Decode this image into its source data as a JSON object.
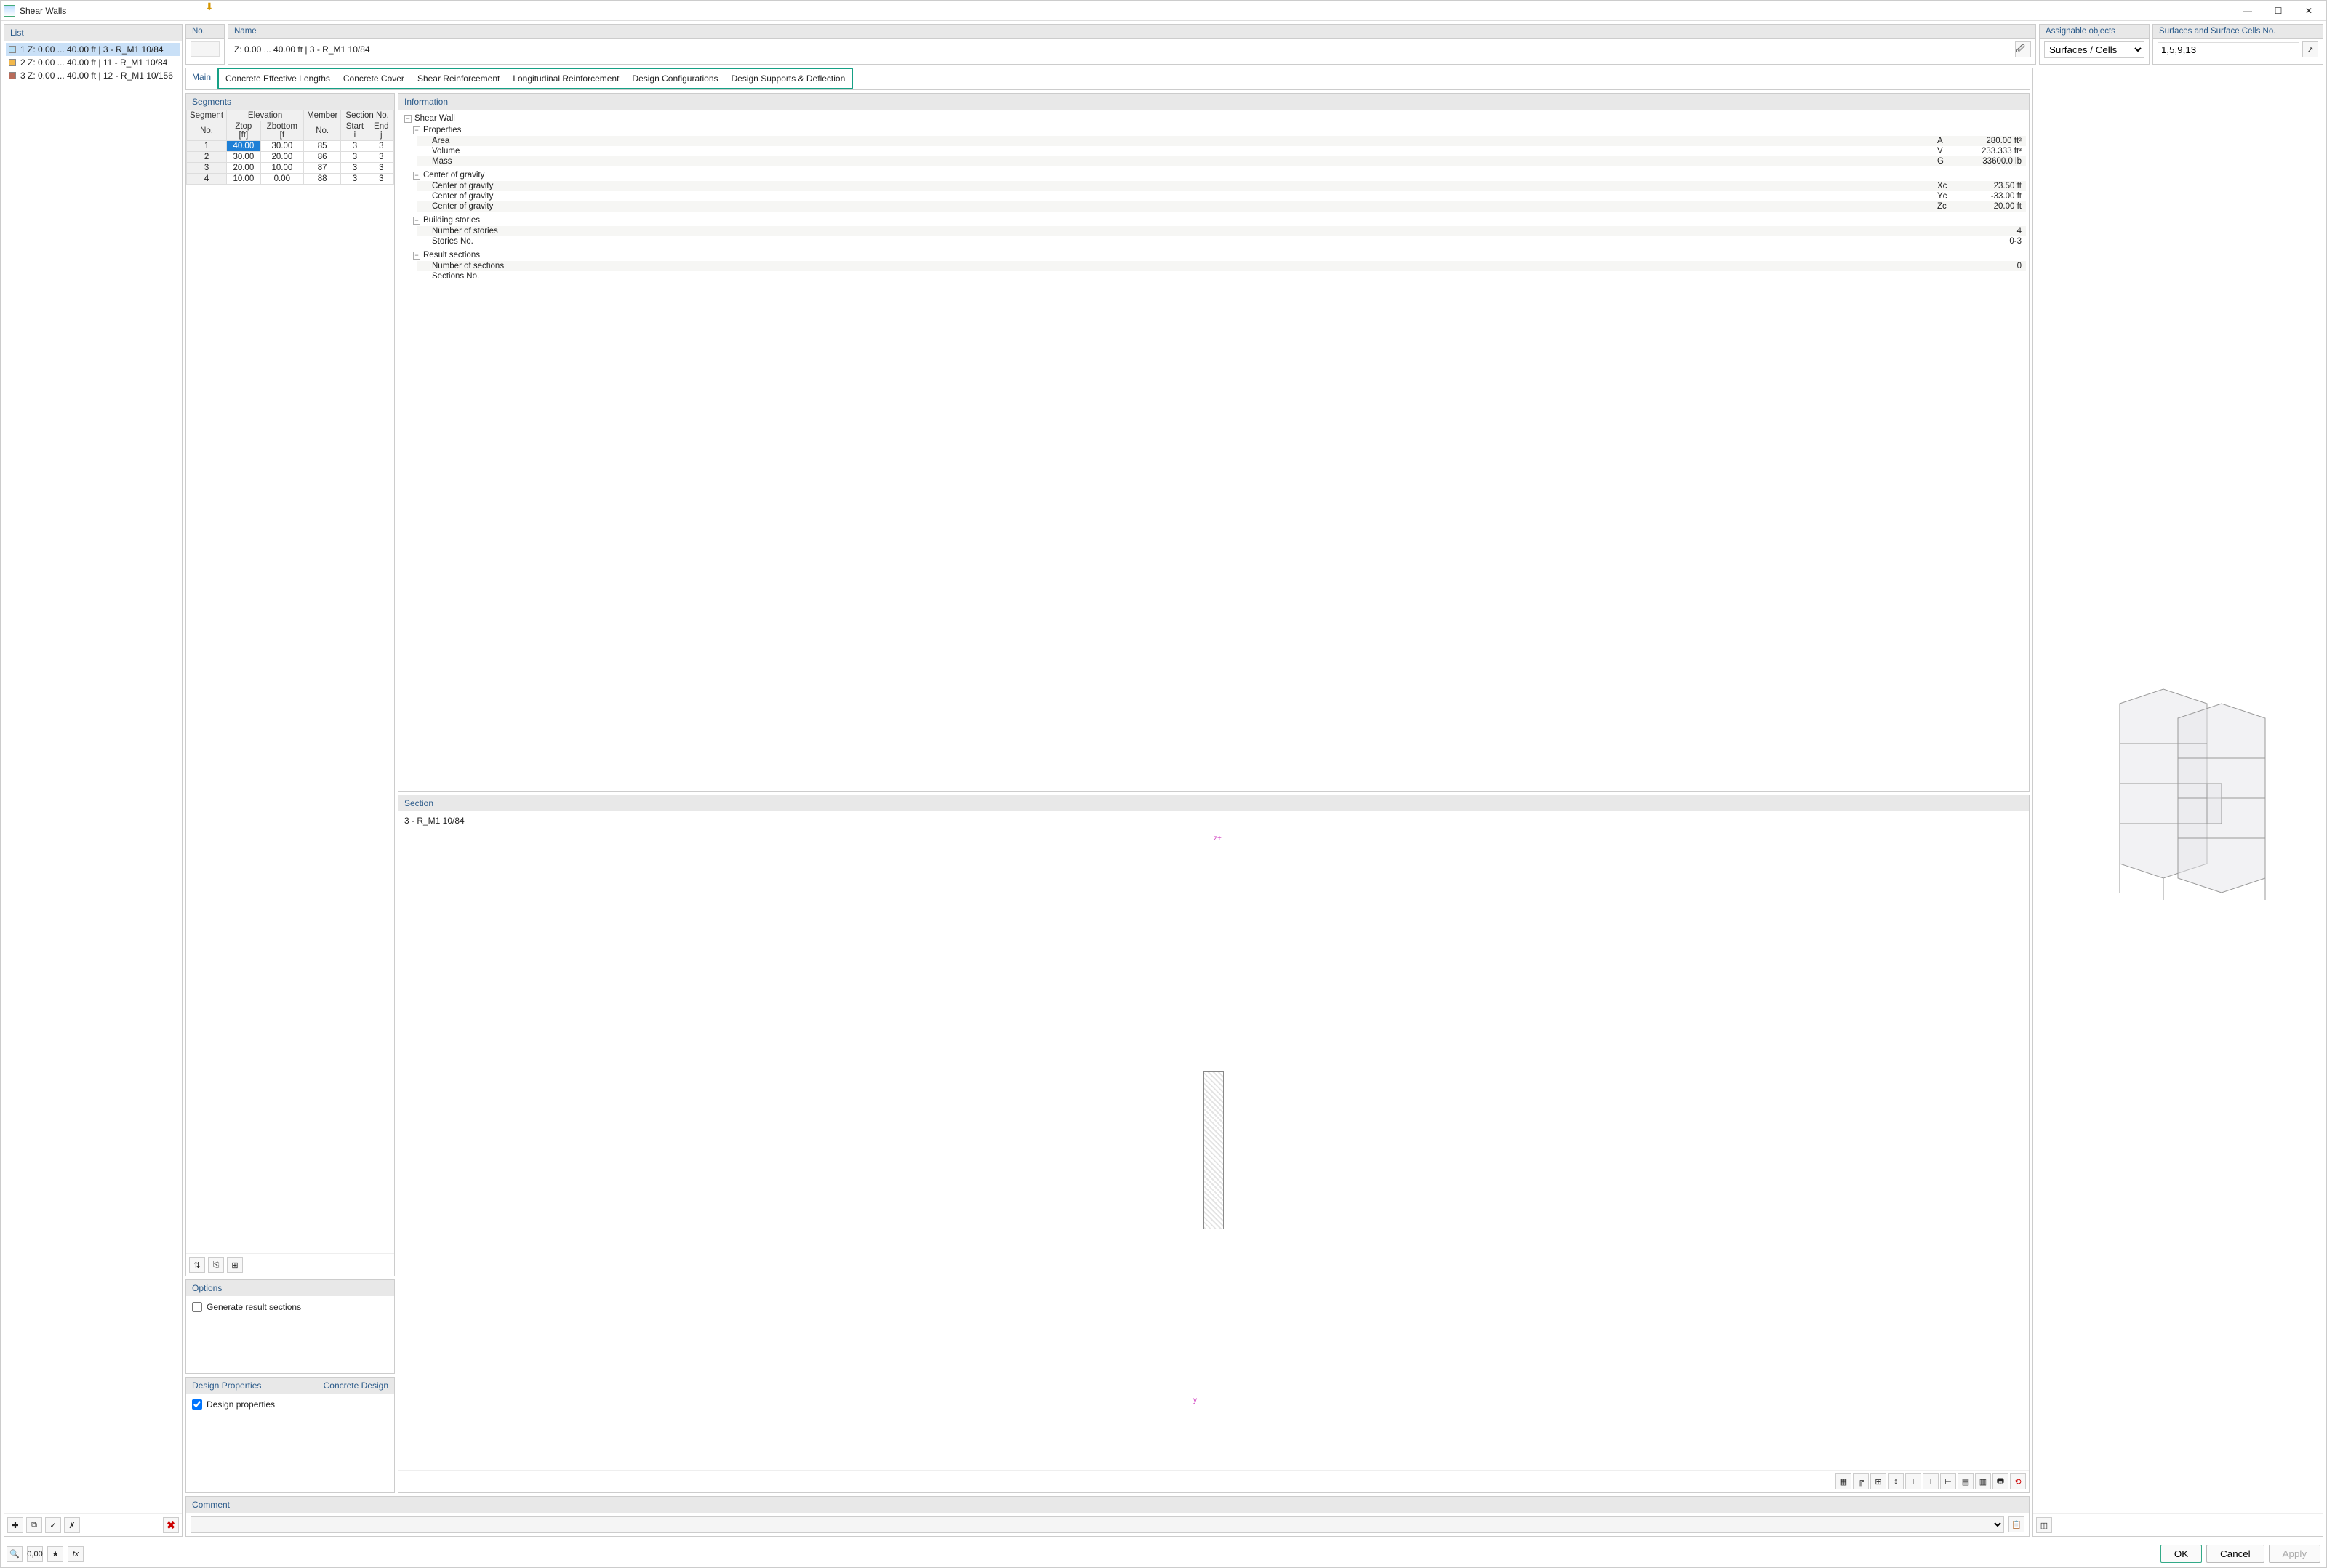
{
  "title": "Shear Walls",
  "list": {
    "header": "List",
    "items": [
      {
        "color": "#b7dff5",
        "label": "1 Z: 0.00 ... 40.00 ft | 3 - R_M1 10/84",
        "selected": true
      },
      {
        "color": "#f2b84b",
        "label": "2 Z: 0.00 ... 40.00 ft | 11 - R_M1 10/84",
        "selected": false
      },
      {
        "color": "#b86b5a",
        "label": "3 Z: 0.00 ... 40.00 ft | 12 - R_M1 10/156",
        "selected": false
      }
    ]
  },
  "no": {
    "header": "No.",
    "value": ""
  },
  "name": {
    "header": "Name",
    "value": "Z: 0.00 ... 40.00  ft | 3 - R_M1 10/84"
  },
  "assignable": {
    "header": "Assignable objects",
    "value": "Surfaces / Cells"
  },
  "surfaces": {
    "header": "Surfaces and Surface Cells No.",
    "value": "1,5,9,13"
  },
  "tabs": {
    "main": "Main",
    "others": [
      "Concrete Effective Lengths",
      "Concrete Cover",
      "Shear Reinforcement",
      "Longitudinal Reinforcement",
      "Design Configurations",
      "Design Supports & Deflection"
    ]
  },
  "segments": {
    "header": "Segments",
    "cols_top": [
      "Segment",
      "Elevation",
      "Member",
      "Section No."
    ],
    "cols_sub": [
      "No.",
      "Ztop [ft]",
      "Zbottom [f",
      "No.",
      "Start i",
      "End j"
    ],
    "rows": [
      [
        "1",
        "40.00",
        "30.00",
        "85",
        "3",
        "3"
      ],
      [
        "2",
        "30.00",
        "20.00",
        "86",
        "3",
        "3"
      ],
      [
        "3",
        "20.00",
        "10.00",
        "87",
        "3",
        "3"
      ],
      [
        "4",
        "10.00",
        "0.00",
        "88",
        "3",
        "3"
      ]
    ],
    "selected_row": 0,
    "selected_col": 1
  },
  "options": {
    "header": "Options",
    "generate_label": "Generate result sections",
    "generate_checked": false
  },
  "design_props": {
    "header": "Design Properties",
    "right_label": "Concrete Design",
    "chk_label": "Design properties",
    "checked": true
  },
  "information": {
    "header": "Information",
    "root": "Shear Wall",
    "groups": [
      {
        "title": "Properties",
        "rows": [
          {
            "lbl": "Area",
            "sym": "A",
            "val": "280.00 ft²"
          },
          {
            "lbl": "Volume",
            "sym": "V",
            "val": "233.333 ft³"
          },
          {
            "lbl": "Mass",
            "sym": "G",
            "val": "33600.0 lb"
          }
        ]
      },
      {
        "title": "Center of gravity",
        "rows": [
          {
            "lbl": "Center of gravity",
            "sym": "Xc",
            "val": "23.50 ft"
          },
          {
            "lbl": "Center of gravity",
            "sym": "Yc",
            "val": "-33.00 ft"
          },
          {
            "lbl": "Center of gravity",
            "sym": "Zc",
            "val": "20.00 ft"
          }
        ]
      },
      {
        "title": "Building stories",
        "rows": [
          {
            "lbl": "Number of stories",
            "sym": "",
            "val": "4"
          },
          {
            "lbl": "Stories No.",
            "sym": "",
            "val": "0-3"
          }
        ]
      },
      {
        "title": "Result sections",
        "rows": [
          {
            "lbl": "Number of sections",
            "sym": "",
            "val": "0"
          },
          {
            "lbl": "Sections No.",
            "sym": "",
            "val": ""
          }
        ]
      }
    ]
  },
  "section": {
    "header": "Section",
    "name": "3 - R_M1 10/84",
    "z_label": "z+",
    "y_label": "y"
  },
  "comment": {
    "header": "Comment",
    "value": ""
  },
  "buttons": {
    "ok": "OK",
    "cancel": "Cancel",
    "apply": "Apply"
  }
}
